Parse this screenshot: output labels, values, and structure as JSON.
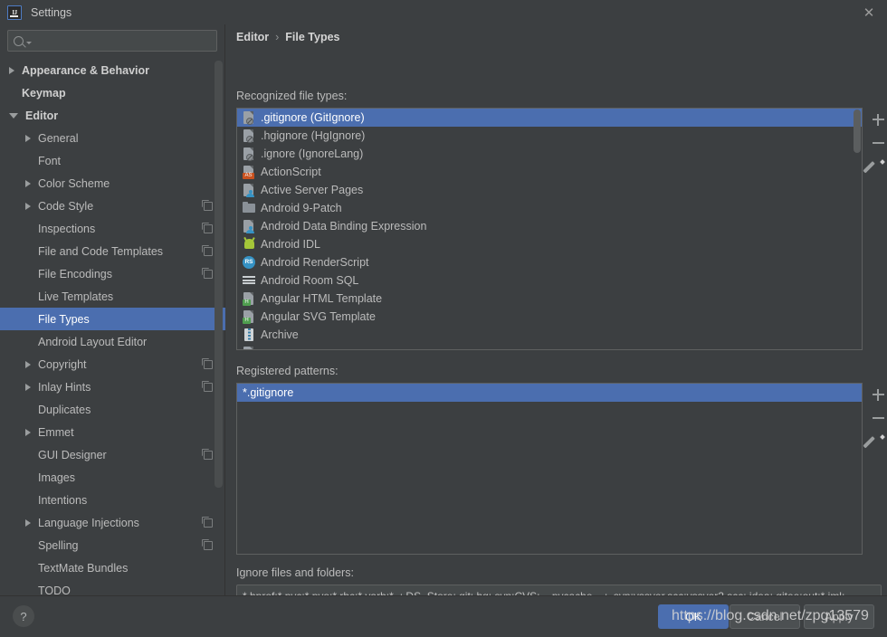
{
  "window": {
    "title": "Settings",
    "logo_text": "IJ",
    "close_icon": "✕"
  },
  "search": {
    "value": "",
    "placeholder": ""
  },
  "sidebar": {
    "items": [
      {
        "label": "Appearance & Behavior",
        "indent": 0,
        "arrow": "closed",
        "bold": true,
        "badge": false,
        "selected": false
      },
      {
        "label": "Keymap",
        "indent": 0,
        "arrow": "none",
        "bold": true,
        "badge": false,
        "selected": false
      },
      {
        "label": "Editor",
        "indent": 0,
        "arrow": "open",
        "bold": true,
        "badge": false,
        "selected": false
      },
      {
        "label": "General",
        "indent": 1,
        "arrow": "closed",
        "bold": false,
        "badge": false,
        "selected": false
      },
      {
        "label": "Font",
        "indent": 1,
        "arrow": "none",
        "bold": false,
        "badge": false,
        "selected": false
      },
      {
        "label": "Color Scheme",
        "indent": 1,
        "arrow": "closed",
        "bold": false,
        "badge": false,
        "selected": false
      },
      {
        "label": "Code Style",
        "indent": 1,
        "arrow": "closed",
        "bold": false,
        "badge": true,
        "selected": false
      },
      {
        "label": "Inspections",
        "indent": 1,
        "arrow": "none",
        "bold": false,
        "badge": true,
        "selected": false
      },
      {
        "label": "File and Code Templates",
        "indent": 1,
        "arrow": "none",
        "bold": false,
        "badge": true,
        "selected": false
      },
      {
        "label": "File Encodings",
        "indent": 1,
        "arrow": "none",
        "bold": false,
        "badge": true,
        "selected": false
      },
      {
        "label": "Live Templates",
        "indent": 1,
        "arrow": "none",
        "bold": false,
        "badge": false,
        "selected": false
      },
      {
        "label": "File Types",
        "indent": 1,
        "arrow": "none",
        "bold": false,
        "badge": false,
        "selected": true
      },
      {
        "label": "Android Layout Editor",
        "indent": 1,
        "arrow": "none",
        "bold": false,
        "badge": false,
        "selected": false
      },
      {
        "label": "Copyright",
        "indent": 1,
        "arrow": "closed",
        "bold": false,
        "badge": true,
        "selected": false
      },
      {
        "label": "Inlay Hints",
        "indent": 1,
        "arrow": "closed",
        "bold": false,
        "badge": true,
        "selected": false
      },
      {
        "label": "Duplicates",
        "indent": 1,
        "arrow": "none",
        "bold": false,
        "badge": false,
        "selected": false
      },
      {
        "label": "Emmet",
        "indent": 1,
        "arrow": "closed",
        "bold": false,
        "badge": false,
        "selected": false
      },
      {
        "label": "GUI Designer",
        "indent": 1,
        "arrow": "none",
        "bold": false,
        "badge": true,
        "selected": false
      },
      {
        "label": "Images",
        "indent": 1,
        "arrow": "none",
        "bold": false,
        "badge": false,
        "selected": false
      },
      {
        "label": "Intentions",
        "indent": 1,
        "arrow": "none",
        "bold": false,
        "badge": false,
        "selected": false
      },
      {
        "label": "Language Injections",
        "indent": 1,
        "arrow": "closed",
        "bold": false,
        "badge": true,
        "selected": false
      },
      {
        "label": "Spelling",
        "indent": 1,
        "arrow": "none",
        "bold": false,
        "badge": true,
        "selected": false
      },
      {
        "label": "TextMate Bundles",
        "indent": 1,
        "arrow": "none",
        "bold": false,
        "badge": false,
        "selected": false
      },
      {
        "label": "TODO",
        "indent": 1,
        "arrow": "none",
        "bold": false,
        "badge": false,
        "selected": false
      }
    ]
  },
  "breadcrumb": {
    "parent": "Editor",
    "separator": "›",
    "current": "File Types"
  },
  "recognized": {
    "label": "Recognized file types:",
    "items": [
      {
        "label": ".gitignore (GitIgnore)",
        "icon": "ignore-file-icon",
        "selected": true
      },
      {
        "label": ".hgignore (HgIgnore)",
        "icon": "ignore-file-icon",
        "selected": false
      },
      {
        "label": ".ignore (IgnoreLang)",
        "icon": "ignore-file-icon",
        "selected": false
      },
      {
        "label": "ActionScript",
        "icon": "actionscript-file-icon",
        "selected": false
      },
      {
        "label": "Active Server Pages",
        "icon": "asp-file-icon",
        "selected": false
      },
      {
        "label": "Android 9-Patch",
        "icon": "folder-icon",
        "selected": false
      },
      {
        "label": "Android Data Binding Expression",
        "icon": "databinding-file-icon",
        "selected": false
      },
      {
        "label": "Android IDL",
        "icon": "android-robot-icon",
        "selected": false
      },
      {
        "label": "Android RenderScript",
        "icon": "renderscript-icon",
        "selected": false
      },
      {
        "label": "Android Room SQL",
        "icon": "sql-table-icon",
        "selected": false
      },
      {
        "label": "Angular HTML Template",
        "icon": "angular-html-icon",
        "selected": false
      },
      {
        "label": "Angular SVG Template",
        "icon": "angular-svg-icon",
        "selected": false
      },
      {
        "label": "Archive",
        "icon": "archive-zip-icon",
        "selected": false
      }
    ],
    "toolbar": [
      {
        "name": "add-file-type-button",
        "icon": "plus-icon"
      },
      {
        "name": "remove-file-type-button",
        "icon": "minus-icon"
      },
      {
        "name": "edit-file-type-button",
        "icon": "pencil-icon"
      }
    ]
  },
  "patterns": {
    "label": "Registered patterns:",
    "items": [
      {
        "label": "*.gitignore",
        "selected": true
      }
    ],
    "toolbar": [
      {
        "name": "add-pattern-button",
        "icon": "plus-icon"
      },
      {
        "name": "remove-pattern-button",
        "icon": "minus-icon"
      },
      {
        "name": "edit-pattern-button",
        "icon": "pencil-icon"
      }
    ]
  },
  "ignore": {
    "label": "Ignore files and folders:",
    "value": "*.hprof;*.pyc;*.pyo;*.rbc;*.yarb;*~;.DS_Store;.git;.hg;.svn;CVS;__pycache__;_svn;vssver.scc;vssver2.scc;.idea;.gitee;out;*.iml;"
  },
  "footer": {
    "help_label": "?",
    "ok_label": "OK",
    "cancel_label": "Cancel",
    "apply_label": "Apply",
    "watermark": "https://blog.csdn.net/zpg13579"
  },
  "colors": {
    "window_bg": "#3c3f41",
    "selection": "#4b6eaf",
    "field_bg": "#45494a",
    "border": "#5e6060",
    "text": "#bbbbbb"
  }
}
